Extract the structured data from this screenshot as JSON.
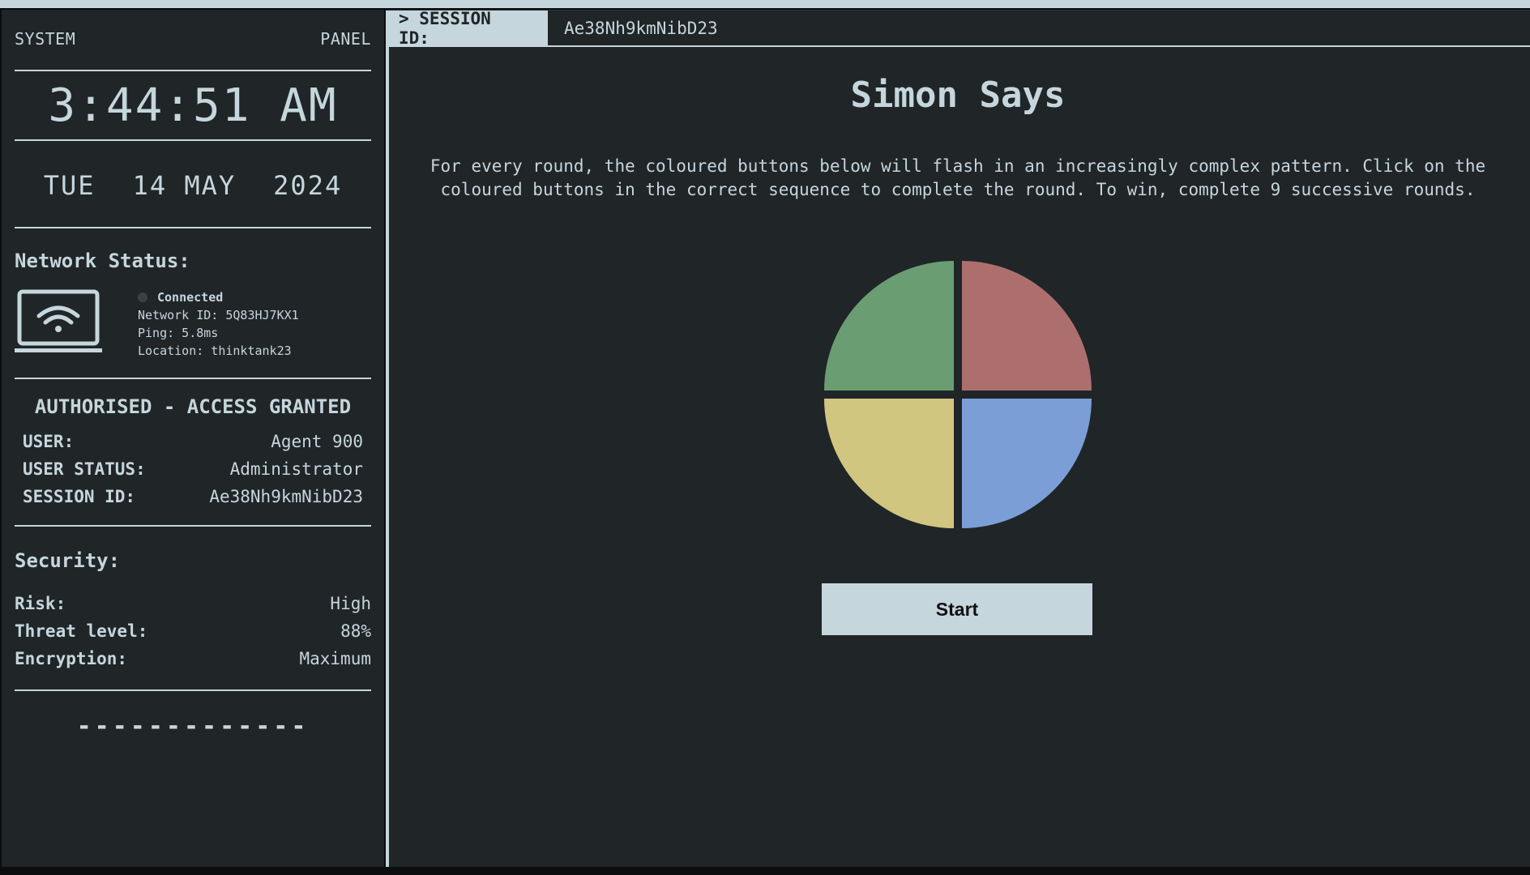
{
  "sidebar": {
    "system_label": "SYSTEM",
    "panel_label": "PANEL",
    "clock": "3:44:51 AM",
    "date": {
      "day": "TUE",
      "daymonth": "14 MAY",
      "year": "2024"
    },
    "network": {
      "title": "Network Status:",
      "status": "Connected",
      "network_id": "Network ID: 5Q83HJ7KX1",
      "ping": "Ping: 5.8ms",
      "location": "Location: thinktank23"
    },
    "auth": {
      "title": "AUTHORISED - ACCESS GRANTED",
      "rows": [
        {
          "key": "USER:",
          "value": "Agent 900"
        },
        {
          "key": "USER STATUS:",
          "value": "Administrator"
        },
        {
          "key": "SESSION ID:",
          "value": "Ae38Nh9kmNibD23"
        }
      ]
    },
    "security": {
      "title": "Security:",
      "rows": [
        {
          "key": "Risk:",
          "value": "High"
        },
        {
          "key": "Threat level:",
          "value": "88%"
        },
        {
          "key": "Encryption:",
          "value": "Maximum"
        }
      ]
    },
    "dashes": "-------------"
  },
  "session_bar": {
    "label": "> SESSION ID:",
    "value": "Ae38Nh9kmNibD23"
  },
  "game": {
    "title": "Simon Says",
    "instructions_line1": "For every round, the coloured buttons below will flash in an increasingly complex pattern. Click on the",
    "instructions_line2": "coloured buttons in the correct sequence to complete the round. To win, complete 9 successive rounds.",
    "start_label": "Start",
    "colors": {
      "green": "#6a9e72",
      "red": "#ad6f6d",
      "yellow": "#d1c67f",
      "blue": "#7c9ed6"
    }
  },
  "icons": {
    "network": "laptop-wifi-icon"
  },
  "theme": {
    "background": "#202528",
    "foreground": "#c5d6dc"
  }
}
